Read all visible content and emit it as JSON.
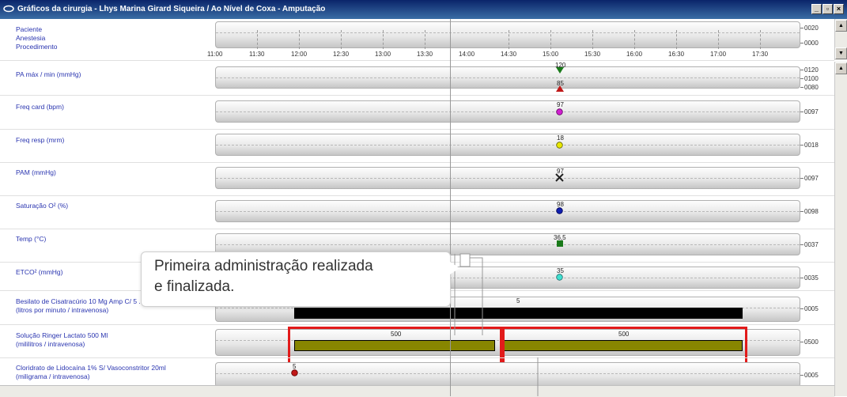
{
  "window": {
    "title": "Gráficos da cirurgia  -  Lhys Marina Girard Siqueira / Ao Nível de Coxa - Amputação",
    "minimize": "_",
    "maximize": "▫",
    "close": "×"
  },
  "header": {
    "labels": [
      "Paciente",
      "Anestesia",
      "Procedimento"
    ],
    "right_values": [
      "0020",
      "0000"
    ],
    "times": [
      "11:00",
      "11:30",
      "12:00",
      "12:30",
      "13:00",
      "13:30",
      "14:00",
      "14:30",
      "15:00",
      "15:30",
      "16:00",
      "16:30",
      "17:00",
      "17:30"
    ]
  },
  "rows": [
    {
      "label": "PA máx / min (mmHg)",
      "right": [
        "0120",
        "0100",
        "0080"
      ],
      "points": [
        {
          "text": "120",
          "shape": "triangle-down",
          "color": "#1a7a1a"
        },
        {
          "text": "85",
          "shape": "triangle-up",
          "color": "#c01818"
        }
      ]
    },
    {
      "label": "Freq card (bpm)",
      "right": [
        "0097"
      ],
      "points": [
        {
          "text": "97",
          "shape": "circle",
          "color": "#d020d0"
        }
      ]
    },
    {
      "label": "Freq resp (mrm)",
      "right": [
        "0018"
      ],
      "points": [
        {
          "text": "18",
          "shape": "circle",
          "color": "#e8e800"
        }
      ]
    },
    {
      "label": "PAM (mmHg)",
      "right": [
        "0097"
      ],
      "points": [
        {
          "text": "97",
          "shape": "x",
          "color": "#222222"
        }
      ]
    },
    {
      "label": "Saturação O² (%)",
      "right": [
        "0098"
      ],
      "points": [
        {
          "text": "98",
          "shape": "circle",
          "color": "#1020b0"
        }
      ]
    },
    {
      "label": "Temp (°C)",
      "right": [
        "0037"
      ],
      "points": [
        {
          "text": "36,5",
          "shape": "square",
          "color": "#1a7a1a"
        }
      ]
    },
    {
      "label": "ETCO² (mmHg)",
      "right": [
        "0035"
      ],
      "points": [
        {
          "text": "35",
          "shape": "circle",
          "color": "#40e0d0"
        }
      ]
    }
  ],
  "infusions": [
    {
      "label1": "Besilato de Cisatracúrio 10 Mg Amp C/ 5 .",
      "label2": "(litros por minuto / intravenosa)",
      "right": "0005",
      "bar_value": "5"
    },
    {
      "label1": "Solução Ringer Lactato 500 Ml",
      "label2": "(mililitros / intravenosa)",
      "right": "0500",
      "bar_values": [
        "500",
        "500"
      ]
    },
    {
      "label1": "Cloridrato de Lidocaína 1% S/ Vasoconstritor 20ml",
      "label2": "(miligrama / intravenosa)",
      "right": "0005",
      "point": "5"
    }
  ],
  "tooltip": {
    "line1": "Primeira administração realizada",
    "line2": "e finalizada."
  },
  "colors": {
    "titlebar": "#0a246a",
    "label_blue": "#2a35b0",
    "highlight_red": "#e21a1a",
    "bar_olive": "#888600"
  }
}
